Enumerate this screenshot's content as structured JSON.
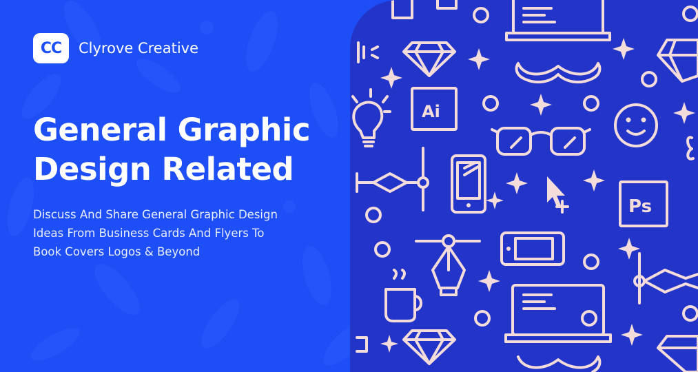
{
  "brand": {
    "logo_text": "CC",
    "name": "Clyrove Creative"
  },
  "hero": {
    "title_line1": "General Graphic",
    "title_line2": "Design Related",
    "subtitle_line1": "Discuss And Share General Graphic Design",
    "subtitle_line2": "Ideas From Business Cards And Flyers To",
    "subtitle_line3": "Book Covers Logos & Beyond"
  },
  "pattern": {
    "ai_label": "Ai",
    "ps_label": "Ps"
  },
  "colors": {
    "left_bg": "#1e4ff6",
    "right_bg": "#2334c8",
    "icon": "#f3dcda",
    "text": "#ffffff"
  }
}
